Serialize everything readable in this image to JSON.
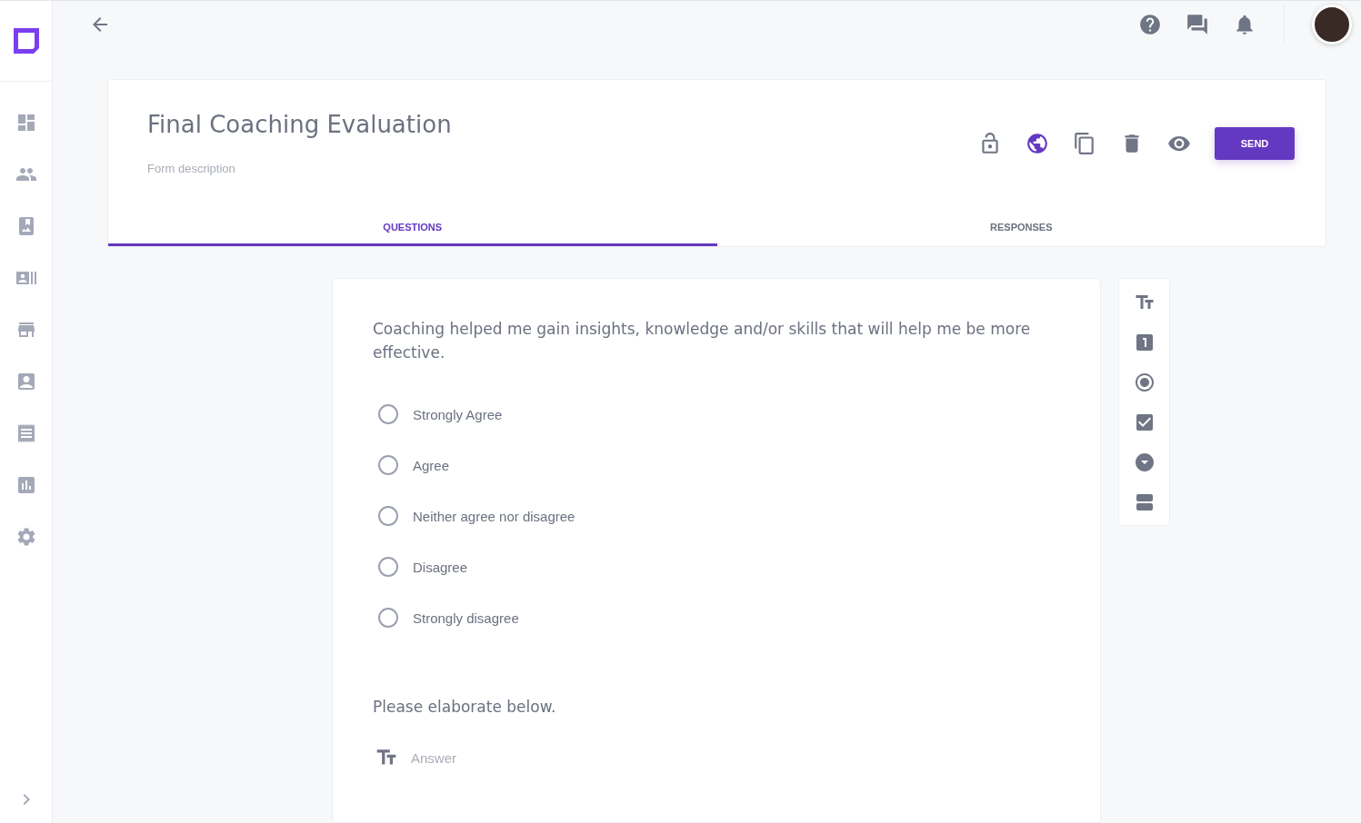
{
  "form": {
    "title": "Final Coaching Evaluation",
    "description_placeholder": "Form description",
    "send_button": "SEND"
  },
  "tabs": [
    {
      "label": "QUESTIONS",
      "selected": true
    },
    {
      "label": "RESPONSES",
      "selected": false
    }
  ],
  "questions": [
    {
      "kind": "choice",
      "text": "Coaching helped me gain insights, knowledge and/or skills that will help me be more effective.",
      "options": [
        {
          "label": "Strongly Agree",
          "selected": false
        },
        {
          "label": "Agree",
          "selected": false
        },
        {
          "label": "Neither agree nor disagree",
          "selected": false
        },
        {
          "label": "Disagree",
          "selected": false
        },
        {
          "label": "Strongly disagree",
          "selected": false
        }
      ]
    },
    {
      "kind": "text",
      "text": "Please elaborate below.",
      "placeholder": "Answer"
    }
  ]
}
